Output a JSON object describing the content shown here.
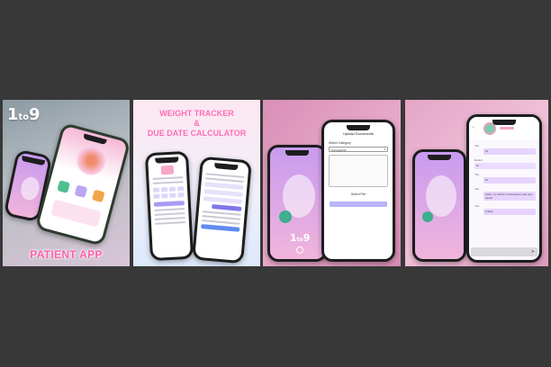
{
  "panel1": {
    "logo_main": "1",
    "logo_sub": "to",
    "logo_end": "9",
    "caption": "PATIENT APP"
  },
  "panel2": {
    "title_line1": "WEIGHT TRACKER",
    "title_line2": "&",
    "title_line3": "DUE DATE CALCULATOR"
  },
  "panel3": {
    "screen_title": "Upload Documents",
    "category_label": "Select Category",
    "category_value": "Sonographic",
    "select_file": "Select File",
    "logo_main": "1",
    "logo_sub": "to",
    "logo_end": "9"
  },
  "panel4": {
    "chat": [
      {
        "sender": "You",
        "text": "Hi"
      },
      {
        "sender": "Doctor",
        "text": "Hi"
      },
      {
        "sender": "You",
        "text": "Hi"
      },
      {
        "sender": "You",
        "text": "Hello, my doctor is that lesson was very useful"
      },
      {
        "sender": "You",
        "text": "Friday"
      }
    ]
  },
  "colors": {
    "brand_pink": "#ff5fa8",
    "accent_purple": "#b9b4f5",
    "background": "#383838"
  }
}
